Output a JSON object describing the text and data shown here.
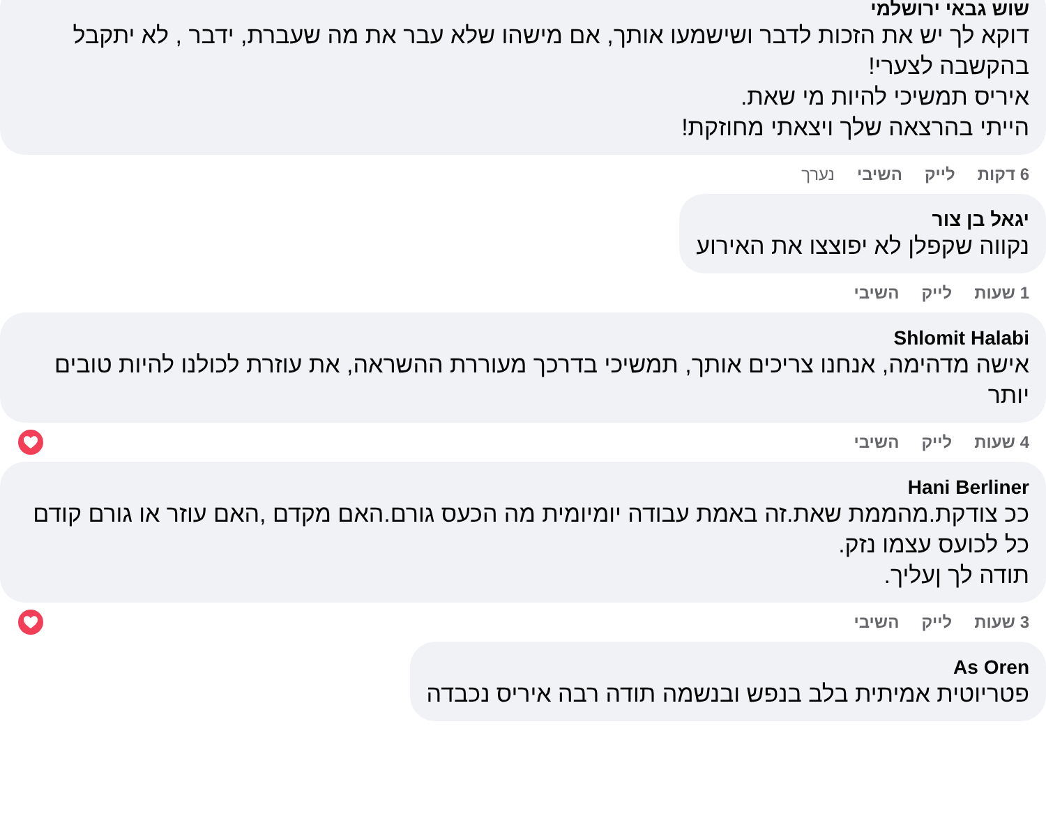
{
  "comments": [
    {
      "author": "שוש גבאי ירושלמי",
      "text": "דוקא לך יש את הזכות לדבר ושישמעו אותך, אם מישהו שלא עבר את מה שעברת, ידבר , לא יתקבל בהקשבה לצערי!\nאיריס תמשיכי להיות מי שאת.\nהייתי בהרצאה שלך ויצאתי מחוזקת!",
      "time": "6 דקות",
      "actions": [
        "לייק",
        "השיבי"
      ],
      "edited": "נערך",
      "reacted": false
    },
    {
      "author": "יגאל בן צור",
      "text": "נקווה שקפלן לא יפוצצו את האירוע",
      "time": "1 שעות",
      "actions": [
        "לייק",
        "השיבי"
      ],
      "reacted": false
    },
    {
      "author": "Shlomit Halabi",
      "text": "אישה מדהימה, אנחנו צריכים אותך, תמשיכי בדרכך מעוררת ההשראה, את עוזרת לכולנו להיות טובים יותר",
      "time": "4 שעות",
      "actions": [
        "לייק",
        "השיבי"
      ],
      "reacted": true
    },
    {
      "author": "Hani Berliner",
      "text": "ככ צודקת.מהממת שאת.זה באמת עבודה יומיומית מה הכעס גורם.האם מקדם ,האם עוזר או גורם קודם כל לכועס עצמו נזק.\nתודה לך ןעליך.",
      "time": "3 שעות",
      "actions": [
        "לייק",
        "השיבי"
      ],
      "reacted": true
    },
    {
      "author": "As Oren",
      "text": "פטריוטית אמיתית בלב בנפש ובנשמה תודה רבה איריס נכבדה"
    }
  ]
}
